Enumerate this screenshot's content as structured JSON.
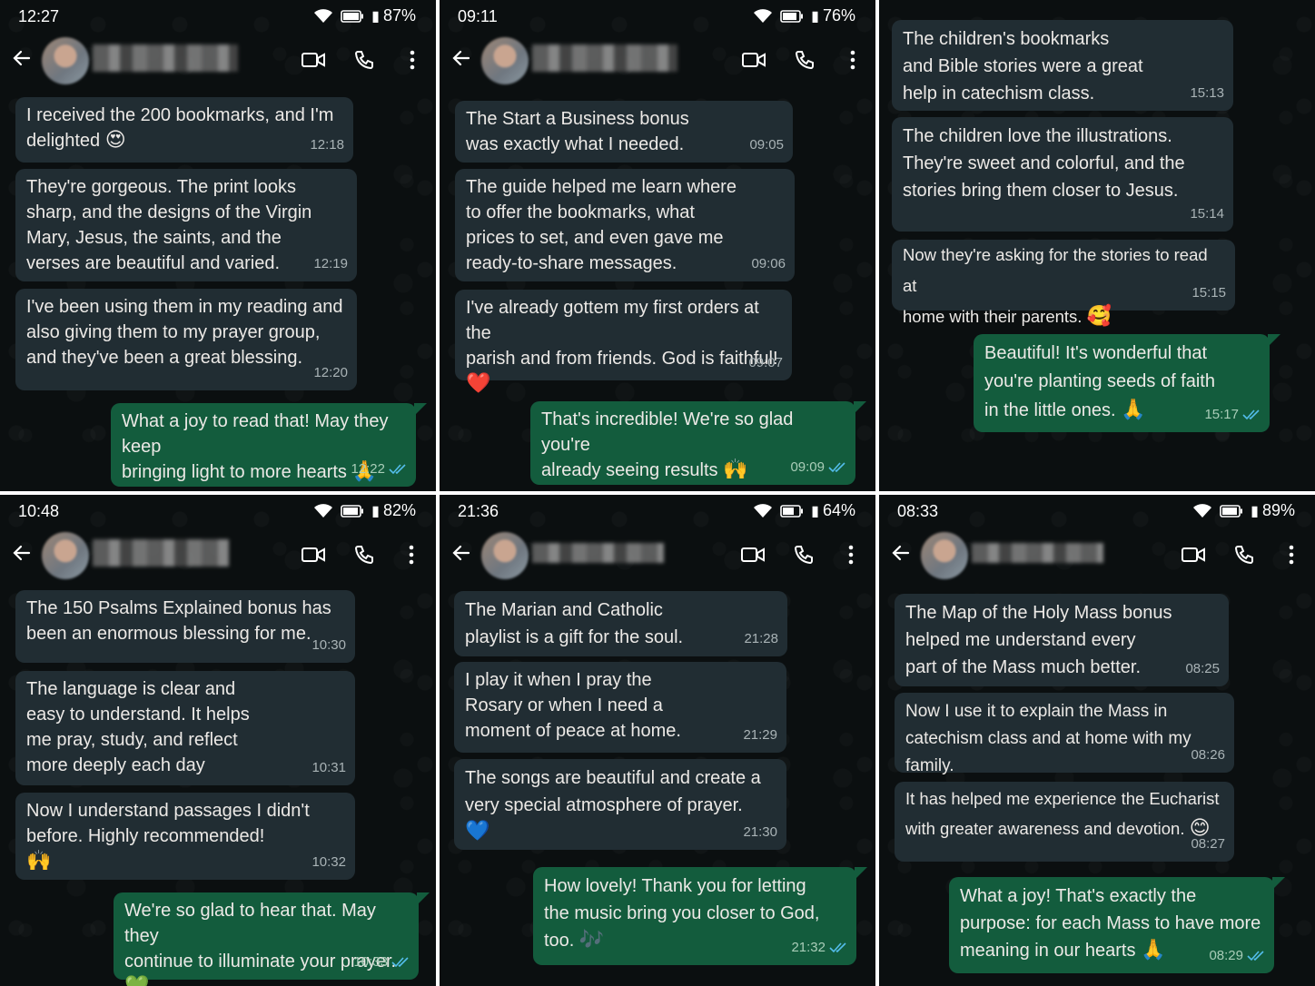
{
  "panels": [
    {
      "time": "12:27",
      "battery": "87%",
      "messages": [
        {
          "dir": "in",
          "text": "I received the 200 bookmarks, and I'm\ndelighted",
          "emoji": "😍",
          "time": "12:18"
        },
        {
          "dir": "in",
          "text": "They're gorgeous. The print looks\nsharp, and the designs of the Virgin\nMary, Jesus, the saints, and the\nverses are beautiful and varied.",
          "emoji": "",
          "time": "12:19"
        },
        {
          "dir": "in",
          "text": "I've been using them in my reading and\nalso giving them to my prayer group,\nand they've been a great blessing.",
          "emoji": "",
          "time": "12:20"
        },
        {
          "dir": "out",
          "text": "What a joy to read that! May they keep\nbringing light to more hearts",
          "emoji": "🙏",
          "time": "12:22"
        }
      ]
    },
    {
      "time": "09:11",
      "battery": "76%",
      "messages": [
        {
          "dir": "in",
          "text": "The Start a Business bonus\nwas exactly what I needed.",
          "emoji": "",
          "time": "09:05"
        },
        {
          "dir": "in",
          "text": "The guide helped me learn where\nto offer the bookmarks, what\nprices to set, and even gave me\nready-to-share messages.",
          "emoji": "",
          "time": "09:06"
        },
        {
          "dir": "in",
          "text": "I've already gottem my first orders at the\nparish and from friends. God is faithful!",
          "emoji": "❤️",
          "time": "09:07"
        },
        {
          "dir": "out",
          "text": "That's incredible! We're so glad you're\nalready seeing results",
          "emoji": "🙌",
          "time": "09:09"
        }
      ]
    },
    {
      "time": "",
      "battery": "",
      "messages": [
        {
          "dir": "in",
          "text": "The children's bookmarks\nand Bible stories were a great\nhelp in catechism class.",
          "emoji": "",
          "time": "15:13"
        },
        {
          "dir": "in",
          "text": "The children love the illustrations.\nThey're sweet and colorful, and the\nstories bring them closer to Jesus.",
          "emoji": "",
          "time": "15:14"
        },
        {
          "dir": "in",
          "text": "Now they're asking for the stories to read at\nhome with their parents.",
          "emoji": "🥰",
          "time": "15:15"
        },
        {
          "dir": "out",
          "text": "Beautiful! It's wonderful that\nyou're planting seeds of faith\nin the little ones.",
          "emoji": "🙏",
          "time": "15:17"
        }
      ]
    },
    {
      "time": "10:48",
      "battery": "82%",
      "messages": [
        {
          "dir": "in",
          "text": "The 150 Psalms Explained bonus has\nbeen an enormous blessing for me.",
          "emoji": "",
          "time": "10:30"
        },
        {
          "dir": "in",
          "text": "The language is clear and\neasy to understand. It helps\nme pray, study, and reflect\nmore deeply each day",
          "emoji": "",
          "time": "10:31"
        },
        {
          "dir": "in",
          "text": "Now I understand passages I didn't\nbefore. Highly recommended!",
          "emoji": "🙌",
          "time": "10:32"
        },
        {
          "dir": "out",
          "text": "We're so glad to hear that. May they\ncontinue to illuminate your prayer.",
          "emoji": "💚",
          "time": "10:33"
        }
      ]
    },
    {
      "time": "21:36",
      "battery": "64%",
      "messages": [
        {
          "dir": "in",
          "text": "The Marian and Catholic\nplaylist is a gift for the soul.",
          "emoji": "",
          "time": "21:28"
        },
        {
          "dir": "in",
          "text": "I play it when I pray the\nRosary or when I need a\nmoment of peace at home.",
          "emoji": "",
          "time": "21:29"
        },
        {
          "dir": "in",
          "text": "The songs are beautiful and create a\nvery special atmosphere of prayer.",
          "emoji": "💙",
          "time": "21:30"
        },
        {
          "dir": "out",
          "text": "How lovely! Thank you for letting\nthe music bring you closer to God,\ntoo.",
          "emoji": "🎶",
          "time": "21:32"
        }
      ]
    },
    {
      "time": "08:33",
      "battery": "89%",
      "messages": [
        {
          "dir": "in",
          "text": "The Map of the Holy Mass bonus\nhelped me understand every\npart of the Mass much better.",
          "emoji": "",
          "time": "08:25"
        },
        {
          "dir": "in",
          "text": "Now I use it to explain the Mass in\ncatechism class and at home with my family.",
          "emoji": "",
          "time": "08:26"
        },
        {
          "dir": "in",
          "text": "It has helped me experience the Eucharist\nwith greater awareness and devotion.",
          "emoji": "😊",
          "time": "08:27"
        },
        {
          "dir": "out",
          "text": "What a joy! That's exactly the\npurpose: for each Mass to have more\nmeaning in our hearts",
          "emoji": "🙏",
          "time": "08:29"
        }
      ]
    }
  ]
}
